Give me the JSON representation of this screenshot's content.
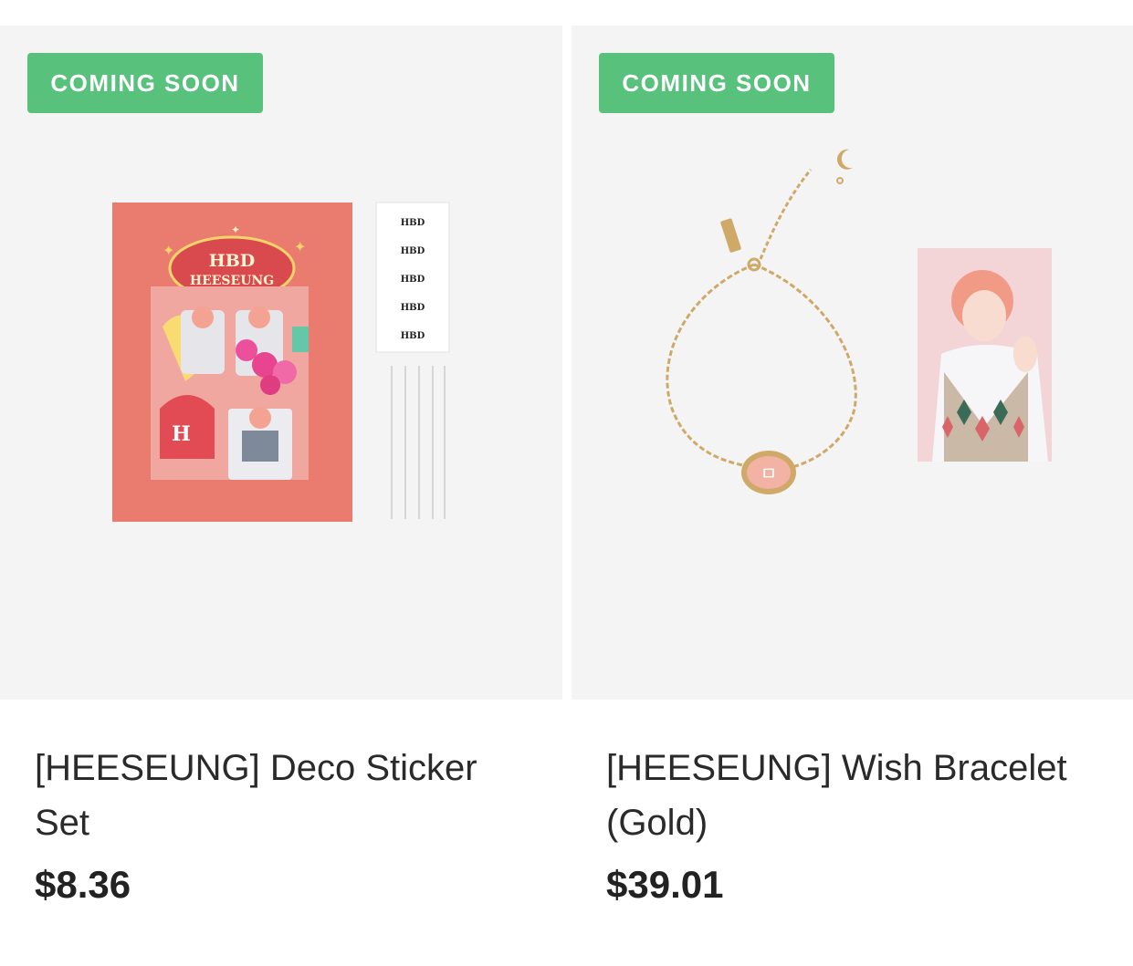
{
  "products": [
    {
      "badge": "COMING SOON",
      "title": "[HEESEUNG] Deco Sticker Set",
      "price": "$8.36",
      "image": {
        "sheet_title_line1": "HBD",
        "sheet_title_line2": "HEESEUNG",
        "strip_labels": [
          "HBD",
          "HBD",
          "HBD",
          "HBD",
          "HBD"
        ]
      }
    },
    {
      "badge": "COMING SOON",
      "title": "[HEESEUNG] Wish Bracelet (Gold)",
      "price": "$39.01"
    }
  ],
  "colors": {
    "badge_bg": "#58c27d",
    "card_bg": "#f4f4f5",
    "sticker_sheet": "#ea7b6f",
    "gold": "#cfa968",
    "charm_pink": "#f2b2a4"
  }
}
